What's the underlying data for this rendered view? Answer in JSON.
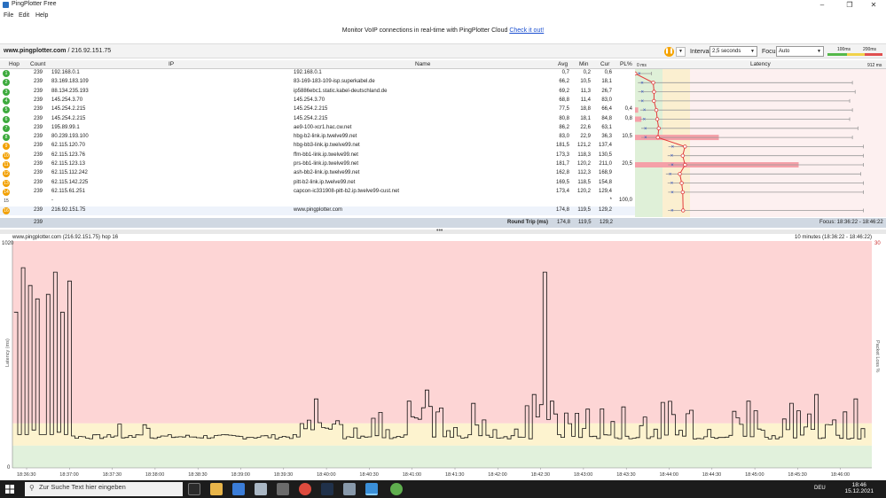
{
  "window": {
    "title": "PingPlotter Free"
  },
  "menu": [
    "File",
    "Edit",
    "Help"
  ],
  "promo": {
    "text": "Monitor VoIP connections in real-time with PingPlotter Cloud",
    "link": "Check it out!"
  },
  "target": {
    "host": "www.pingplotter.com",
    "ip": "/ 216.92.151.75"
  },
  "controls": {
    "interval_label": "Interval",
    "interval_value": "2,5 seconds",
    "focus_label": "Focus",
    "focus_value": "Auto",
    "scale_100": "100ms",
    "scale_200": "200ms"
  },
  "table": {
    "headers": {
      "hop": "Hop",
      "count": "Count",
      "ip": "IP",
      "name": "Name",
      "avg": "Avg",
      "min": "Min",
      "cur": "Cur",
      "pl": "PL%",
      "latency": "Latency",
      "lat_min": "0 ms",
      "lat_max": "912 ms"
    },
    "rows": [
      {
        "hop": "1",
        "count": "239",
        "ip": "192.168.0.1",
        "name": "192.168.0.1",
        "avg": "0,7",
        "min": "0,2",
        "cur": "0,6",
        "pl": "",
        "color": "#3daa3d",
        "avgms": 0.7,
        "minms": 0.2,
        "maxms": 60
      },
      {
        "hop": "2",
        "count": "239",
        "ip": "83.169.183.109",
        "name": "83-169-183-109-isp.superkabel.de",
        "avg": "66,2",
        "min": "10,5",
        "cur": "18,1",
        "pl": "",
        "color": "#3daa3d",
        "avgms": 66.2,
        "minms": 10.5,
        "maxms": 790
      },
      {
        "hop": "3",
        "count": "239",
        "ip": "88.134.235.193",
        "name": "ip5886ebc1.static.kabel-deutschland.de",
        "avg": "69,2",
        "min": "11,3",
        "cur": "26,7",
        "pl": "",
        "color": "#3daa3d",
        "avgms": 69.2,
        "minms": 11.3,
        "maxms": 800
      },
      {
        "hop": "4",
        "count": "239",
        "ip": "145.254.3.70",
        "name": "145.254.3.70",
        "avg": "68,8",
        "min": "11,4",
        "cur": "83,0",
        "pl": "",
        "color": "#3daa3d",
        "avgms": 68.8,
        "minms": 11.4,
        "maxms": 780
      },
      {
        "hop": "5",
        "count": "239",
        "ip": "145.254.2.215",
        "name": "145.254.2.215",
        "avg": "77,5",
        "min": "18,8",
        "cur": "66,4",
        "pl": "0,4",
        "color": "#3daa3d",
        "avgms": 77.5,
        "minms": 18.8,
        "maxms": 790
      },
      {
        "hop": "6",
        "count": "239",
        "ip": "145.254.2.215",
        "name": "145.254.2.215",
        "avg": "80,8",
        "min": "18,1",
        "cur": "84,8",
        "pl": "0,8",
        "color": "#3daa3d",
        "avgms": 80.8,
        "minms": 18.1,
        "maxms": 780
      },
      {
        "hop": "7",
        "count": "239",
        "ip": "195.89.99.1",
        "name": "ae9-100-xcr1.hac.cw.net",
        "avg": "86,2",
        "min": "22,6",
        "cur": "63,1",
        "pl": "",
        "color": "#3daa3d",
        "avgms": 86.2,
        "minms": 22.6,
        "maxms": 810
      },
      {
        "hop": "8",
        "count": "239",
        "ip": "80.239.193.100",
        "name": "hbg-b2-link.ip.twelve99.net",
        "avg": "83,0",
        "min": "22,9",
        "cur": "36,3",
        "pl": "10,5",
        "color": "#3daa3d",
        "avgms": 83.0,
        "minms": 22.9,
        "maxms": 790
      },
      {
        "hop": "9",
        "count": "239",
        "ip": "62.115.120.70",
        "name": "hbg-bb3-link.ip.twelve99.net",
        "avg": "181,5",
        "min": "121,2",
        "cur": "137,4",
        "pl": "",
        "color": "#f2a000",
        "avgms": 181.5,
        "minms": 121.2,
        "maxms": 830
      },
      {
        "hop": "10",
        "count": "239",
        "ip": "62.115.123.76",
        "name": "ffm-bb1-link.ip.twelve99.net",
        "avg": "173,3",
        "min": "118,3",
        "cur": "130,5",
        "pl": "",
        "color": "#f2a000",
        "avgms": 173.3,
        "minms": 118.3,
        "maxms": 830
      },
      {
        "hop": "11",
        "count": "239",
        "ip": "62.115.123.13",
        "name": "prs-bb1-link.ip.twelve99.net",
        "avg": "181,7",
        "min": "120,2",
        "cur": "211,0",
        "pl": "20,5",
        "color": "#f2a000",
        "avgms": 181.7,
        "minms": 120.2,
        "maxms": 830
      },
      {
        "hop": "12",
        "count": "239",
        "ip": "62.115.112.242",
        "name": "ash-bb2-link.ip.twelve99.net",
        "avg": "162,8",
        "min": "112,3",
        "cur": "168,9",
        "pl": "",
        "color": "#f2a000",
        "avgms": 162.8,
        "minms": 112.3,
        "maxms": 820
      },
      {
        "hop": "13",
        "count": "239",
        "ip": "62.115.142.225",
        "name": "pitt-b2-link.ip.twelve99.net",
        "avg": "169,5",
        "min": "118,5",
        "cur": "154,8",
        "pl": "",
        "color": "#f2a000",
        "avgms": 169.5,
        "minms": 118.5,
        "maxms": 830
      },
      {
        "hop": "14",
        "count": "239",
        "ip": "62.115.61.251",
        "name": "capcon-ic331908-pitt-b2.ip.twelve99-cust.net",
        "avg": "173,4",
        "min": "120,2",
        "cur": "129,4",
        "pl": "",
        "color": "#f2a000",
        "avgms": 173.4,
        "minms": 120.2,
        "maxms": 830
      },
      {
        "hop": "15",
        "count": "",
        "ip": "-",
        "name": "",
        "avg": "",
        "min": "",
        "cur": "*",
        "pl": "100,0",
        "color": "",
        "avgms": null,
        "minms": null,
        "maxms": null
      },
      {
        "hop": "16",
        "count": "239",
        "ip": "216.92.151.75",
        "name": "www.pingplotter.com",
        "avg": "174,8",
        "min": "119,5",
        "cur": "129,2",
        "pl": "",
        "color": "#f2a000",
        "avgms": 174.8,
        "minms": 119.5,
        "maxms": 830
      }
    ],
    "round_trip": {
      "count": "239",
      "label": "Round Trip (ms)",
      "avg": "174,8",
      "min": "119,5",
      "cur": "129,2",
      "focus": "Focus: 18:36:22 - 18:46:22"
    }
  },
  "graph": {
    "title": "www.pingplotter.com (216.92.151.75) hop 16",
    "range": "10 minutes (18:36:22 - 18:46:22)",
    "ylabel": "Latency (ms)",
    "y2label": "Packet Loss %",
    "ymax_label": "1020",
    "y0_label": "0",
    "y2max_label": "30",
    "times": [
      "18:36:30",
      "18:37:00",
      "18:37:30",
      "18:38:00",
      "18:38:30",
      "18:39:00",
      "18:39:30",
      "18:40:00",
      "18:40:30",
      "18:41:00",
      "18:41:30",
      "18:42:00",
      "18:42:30",
      "18:43:00",
      "18:43:30",
      "18:44:00",
      "18:44:30",
      "18:45:00",
      "18:45:30",
      "18:46:00"
    ]
  },
  "taskbar": {
    "search_placeholder": "Zur Suche Text hier eingeben",
    "time": "18:46",
    "date": "15.12.2021",
    "lang": "DEU"
  }
}
